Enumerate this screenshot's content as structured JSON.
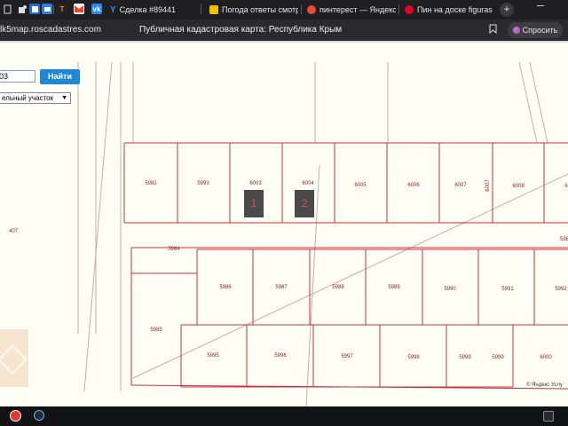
{
  "browser": {
    "tabs": [
      {
        "label": "Сделка #89441",
        "icon": "y-icon",
        "color": "#3d8bfd",
        "active": false
      },
      {
        "label": "Погода ответы смотр",
        "icon": "ya-icon",
        "color": "#f2c200",
        "active": false
      },
      {
        "label": "пинтерест — Яндекс",
        "icon": "ya-search-icon",
        "color": "#e34b3a",
        "active": false
      },
      {
        "label": "Пин на доске figuras",
        "icon": "pinterest-icon",
        "color": "#e60023",
        "active": false
      }
    ],
    "new_tab": "+",
    "address": "lk5map.roscadastres.com",
    "page_title": "Публичная кадастровая карта: Республика Крым",
    "ask_button": "Спросить",
    "pinned_tabs": [
      {
        "icon": "doc-icon",
        "color": "#ffffff"
      },
      {
        "icon": "puzzle-icon",
        "color": "#ffffff"
      },
      {
        "icon": "flag-icon",
        "color": "#1e88e5"
      },
      {
        "icon": "mail-icon",
        "color": "#2a7de1"
      },
      {
        "icon": "t-icon",
        "color": "#ff5722"
      },
      {
        "icon": "gmail-icon",
        "color": "#ea4335"
      },
      {
        "icon": "vk-icon",
        "color": "#2787f5"
      }
    ]
  },
  "map": {
    "search_value": "03",
    "search_button": "Найти",
    "parcel_type": "ельный участок",
    "markers": [
      "1",
      "2"
    ],
    "copyright": "© Яндекс  Услу",
    "parcels_row1": [
      "5982",
      "5993",
      "6003",
      "6004",
      "6005",
      "6006",
      "6007",
      "6008",
      "6"
    ],
    "parcel_6007_vertical": "6007",
    "parcel_5984": "5984",
    "parcel_5980": "598",
    "parcels_row2": [
      "5986",
      "5987",
      "5988",
      "5989",
      "5990",
      "5991",
      "5992"
    ],
    "parcel_5985": "5985",
    "parcels_row3": [
      "5995",
      "5996",
      "5997",
      "5998",
      "5999",
      "5999",
      "6000"
    ],
    "parcel_407": "407",
    "boundary_color": "#c8323a",
    "road_color": "#d4a7a7"
  }
}
